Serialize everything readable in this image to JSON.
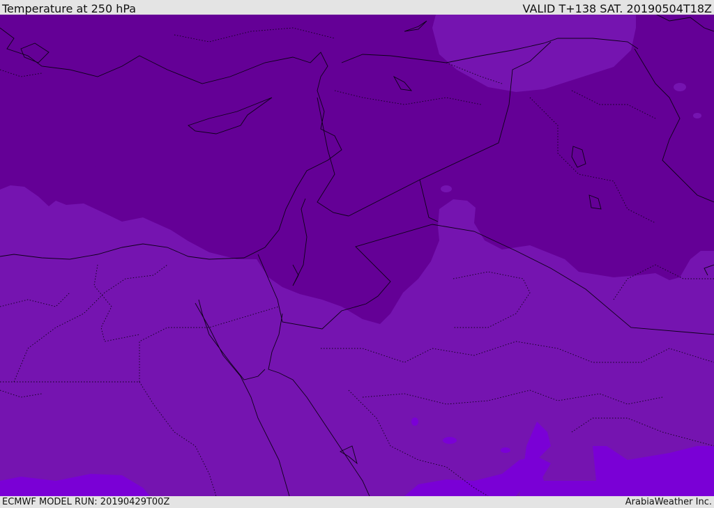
{
  "header": {
    "title": "Temperature at 250 hPa",
    "valid": "VALID T+138 SAT. 20190504T18Z"
  },
  "footer": {
    "model_run": "ECMWF MODEL RUN: 20190429T00Z",
    "credit": "ArabiaWeather Inc."
  },
  "map": {
    "colors": {
      "coldest": "#640096",
      "cold": "#7514b0",
      "mid": "#7a00d6",
      "border": "#0d0018"
    }
  }
}
